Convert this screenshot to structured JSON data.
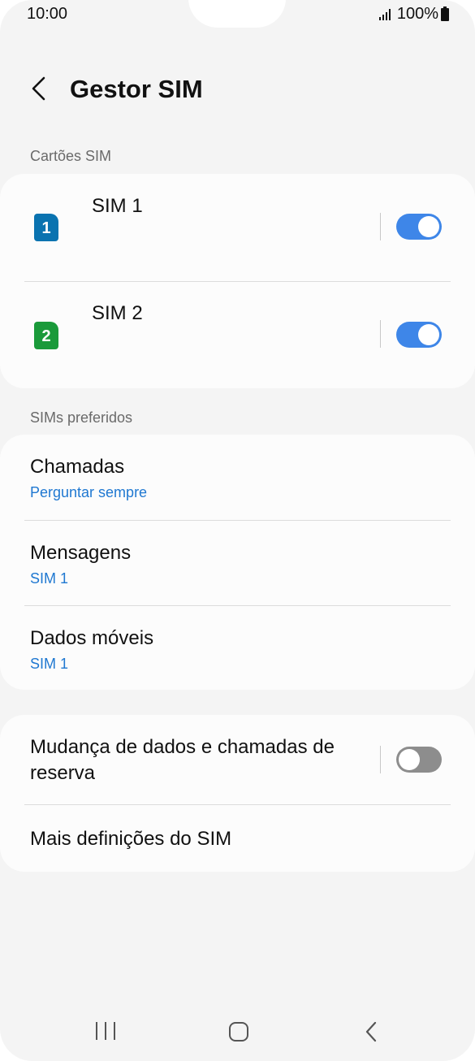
{
  "status_bar": {
    "time": "10:00",
    "battery": "100%"
  },
  "header": {
    "title": "Gestor SIM"
  },
  "sim_cards": {
    "label": "Cartões SIM",
    "items": [
      {
        "number": "1",
        "name": "SIM 1",
        "enabled": true,
        "color": "#0a73b0"
      },
      {
        "number": "2",
        "name": "SIM 2",
        "enabled": true,
        "color": "#1a9a3a"
      }
    ]
  },
  "preferred": {
    "label": "SIMs preferidos",
    "items": [
      {
        "title": "Chamadas",
        "value": "Perguntar sempre"
      },
      {
        "title": "Mensagens",
        "value": "SIM 1"
      },
      {
        "title": "Dados móveis",
        "value": "SIM 1"
      }
    ]
  },
  "more": {
    "data_switch": {
      "title_line1": "Mudança de dados e chamadas de",
      "title_line2": "reserva",
      "enabled": false
    },
    "more_settings": "Mais definições do SIM"
  },
  "colors": {
    "accent": "#3e86e8",
    "link": "#1f78d1"
  }
}
